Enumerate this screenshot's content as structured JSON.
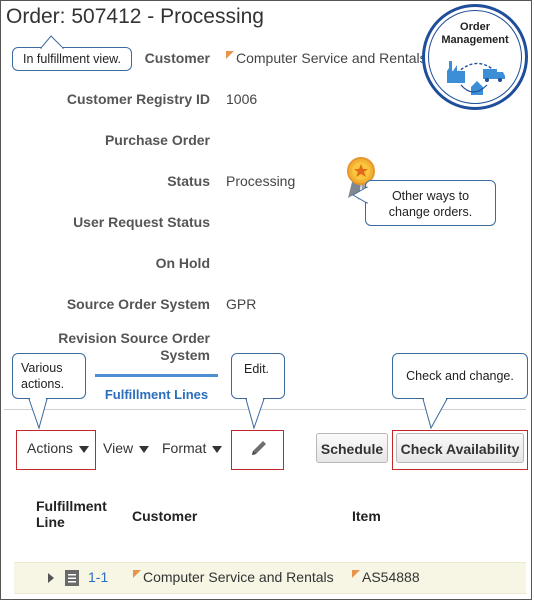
{
  "page_title": "Order: 507412 - Processing",
  "fields": {
    "customer": {
      "label": "Customer",
      "value": "Computer Service and Rentals"
    },
    "registry": {
      "label": "Customer Registry ID",
      "value": "1006"
    },
    "po": {
      "label": "Purchase Order",
      "value": ""
    },
    "status": {
      "label": "Status",
      "value": "Processing"
    },
    "user_request_status": {
      "label": "User Request Status",
      "value": ""
    },
    "on_hold": {
      "label": "On Hold",
      "value": ""
    },
    "source_system": {
      "label": "Source Order System",
      "value": "GPR"
    },
    "revision_line1": "Revision Source Order",
    "revision_line2": "System"
  },
  "callouts": {
    "fulfillment_view": "In fulfillment view.",
    "other_ways_line1": "Other ways to",
    "other_ways_line2": "change orders.",
    "various_line1": "Various",
    "various_line2": "actions.",
    "edit": "Edit.",
    "check_change": "Check and change."
  },
  "logo": {
    "line1": "Order",
    "line2": "Management"
  },
  "tabs": {
    "active": "Fulfillment Lines"
  },
  "toolbar": {
    "actions": "Actions",
    "view": "View",
    "format": "Format",
    "schedule": "Schedule",
    "check_availability": "Check Availability"
  },
  "table": {
    "headers": {
      "line_1": "Fulfillment",
      "line_2": "Line",
      "customer": "Customer",
      "item": "Item"
    },
    "rows": [
      {
        "line": "1-1",
        "customer": "Computer Service and Rentals",
        "item": "AS54888"
      }
    ]
  },
  "colors": {
    "accent": "#2a6ebd",
    "highlight": "#c1272d",
    "callout_border": "#3d6a9e",
    "row_bg": "#f7f5e4"
  }
}
